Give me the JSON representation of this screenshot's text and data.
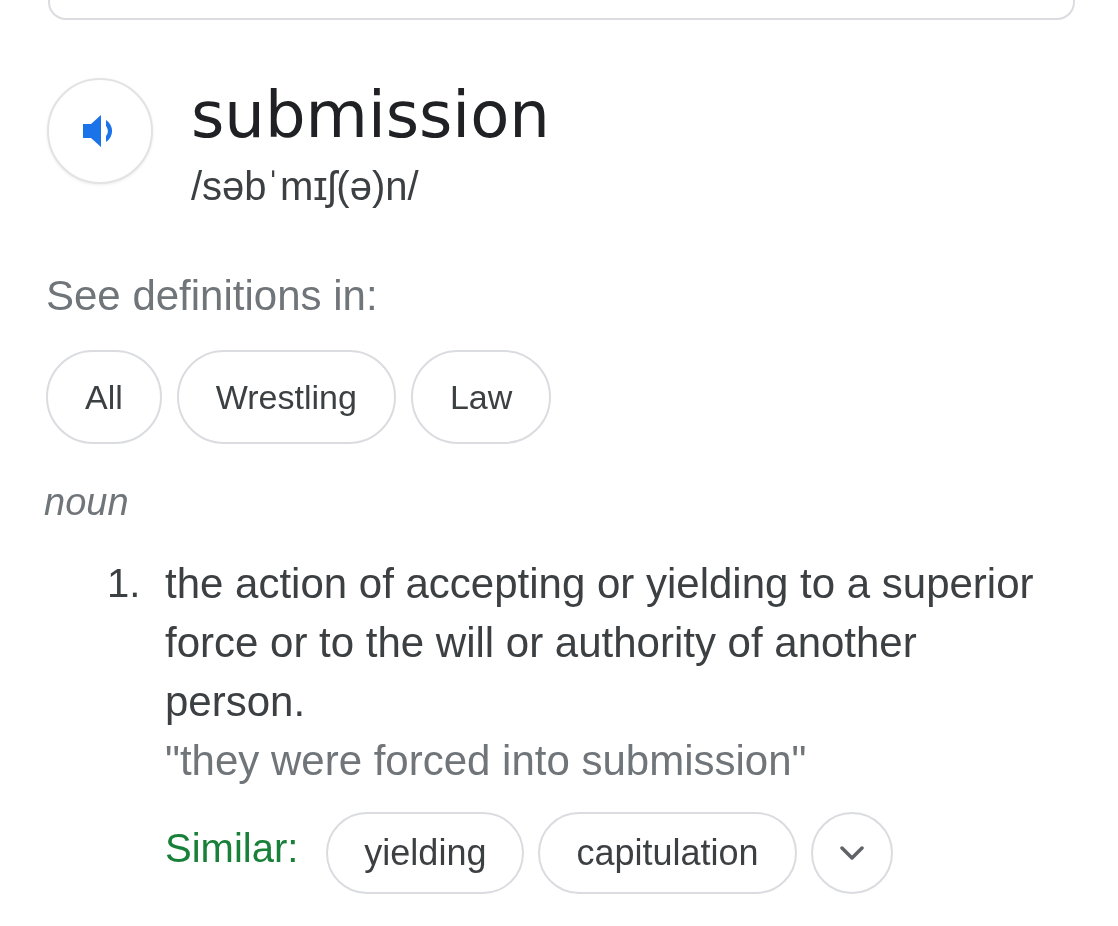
{
  "entry": {
    "word": "submission",
    "pronunciation": "/səbˈmɪʃ(ə)n/"
  },
  "sources": {
    "label": "See definitions in:",
    "chips": [
      {
        "label": "All",
        "selected": false
      },
      {
        "label": "Wrestling",
        "selected": false
      },
      {
        "label": "Law",
        "selected": false
      }
    ]
  },
  "part_of_speech": "noun",
  "senses": [
    {
      "number": "1.",
      "definition": "the action of accepting or yielding to a superior force or to the will or authority of another person.",
      "example": "\"they were forced into submission\"",
      "similar_label": "Similar:",
      "similar": [
        "yielding",
        "capitulation"
      ]
    }
  ]
}
